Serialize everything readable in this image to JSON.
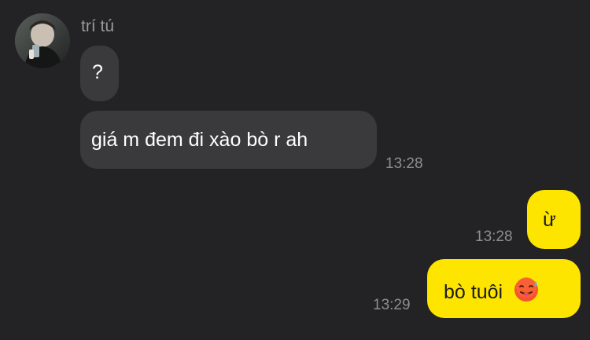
{
  "conversation": {
    "sender_name": "trí tú",
    "messages": [
      {
        "direction": "incoming",
        "text": "?",
        "time": ""
      },
      {
        "direction": "incoming",
        "text": "giá m đem đi xào bò r ah",
        "time": "13:28"
      },
      {
        "direction": "outgoing",
        "text": "ừ",
        "time": "13:28"
      },
      {
        "direction": "outgoing",
        "text": "bò tuôi",
        "emoji": "hot-face-emoji",
        "time": "13:29"
      }
    ]
  },
  "colors": {
    "background": "#232325",
    "incoming_bubble": "#3a3a3c",
    "outgoing_bubble": "#fde500",
    "timestamp": "#8e8e90"
  }
}
